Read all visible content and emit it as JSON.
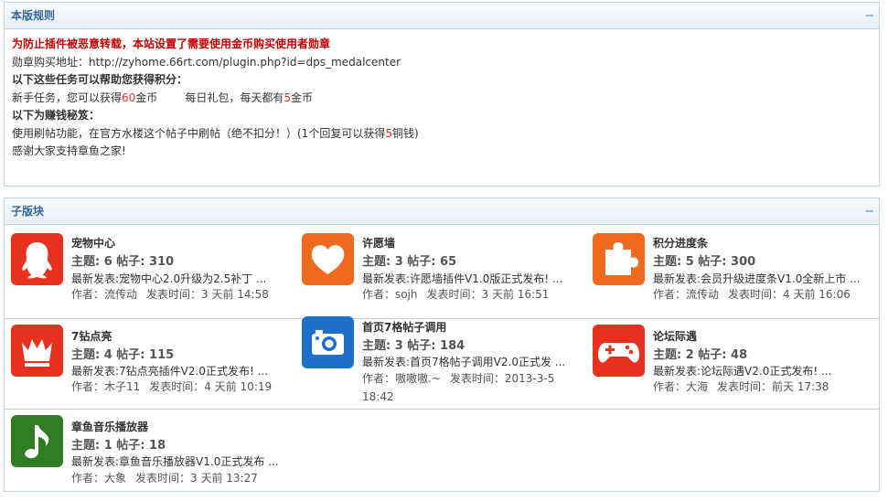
{
  "rules": {
    "header": "本版规则",
    "lines": {
      "warning": "为防止插件被恶意转载，本站设置了需要使用金币购买使用者勋章",
      "address_label": "勋章购买地址：",
      "address_url": "http://zyhome.66rt.com/plugin.php?id=dps_medalcenter",
      "tasks_heading": "以下这些任务可以帮助您获得积分：",
      "task1_pre": "新手任务，您可以获得",
      "task1_num": "60",
      "task1_post": "金币",
      "task2_pre": "每日礼包，每天都有",
      "task2_num": "5",
      "task2_post": "金币",
      "money_heading": "以下为赚钱秘笈：",
      "money_pre": "使用刷帖功能，在官方水楼这个帖子中刷帖（绝不扣分！）(1个回复可以获得",
      "money_num": "5",
      "money_post": "铜钱)",
      "thanks": "感谢大家支持章鱼之家!"
    }
  },
  "subforums": {
    "header": "子版块",
    "items": [
      {
        "title": "宠物中心",
        "stats": "主题: 6 帖子: 310",
        "last": "最新发表:宠物中心2.0升级为2.5补丁 ...",
        "author": "作者：流传动",
        "time": "发表时间：3 天前 14:58",
        "icon": "qq-penguin-icon",
        "color": "#e8301f"
      },
      {
        "title": "许愿墙",
        "stats": "主题: 3 帖子: 65",
        "last": "最新发表:许愿墙插件V1.0版正式发布! ...",
        "author": "作者：sojh",
        "time": "发表时间：3 天前 16:51",
        "icon": "heart-icon",
        "color": "#f06a1d"
      },
      {
        "title": "积分进度条",
        "stats": "主题: 5 帖子: 300",
        "last": "最新发表:会员升级进度条V1.0全新上市 ...",
        "author": "作者：流传动",
        "time": "发表时间：4 天前 16:06",
        "icon": "puzzle-icon",
        "color": "#f06a1d"
      },
      {
        "title": "7钻点亮",
        "stats": "主题: 4 帖子: 115",
        "last": "最新发表:7钻点亮插件V2.0正式发布! ...",
        "author": "作者：木子11",
        "time": "发表时间：4 天前 10:19",
        "icon": "crown-icon",
        "color": "#e8301f"
      },
      {
        "title": "首页7格帖子调用",
        "stats": "主题: 3 帖子: 184",
        "last": "最新发表:首页7格帖子调用V2.0正式发 ...",
        "author": "作者：嗷嗷嗷.~",
        "time": "发表时间：2013-3-5 18:42",
        "icon": "camera-icon",
        "color": "#1e6fc8"
      },
      {
        "title": "论坛际遇",
        "stats": "主题: 2 帖子: 48",
        "last": "最新发表:论坛际遇V2.0正式发布! ...",
        "author": "作者：大海",
        "time": "发表时间：前天 17:38",
        "icon": "gamepad-icon",
        "color": "#e8301f"
      },
      {
        "title": "章鱼音乐播放器",
        "stats": "主题: 1 帖子: 18",
        "last": "最新发表:章鱼音乐播放器V1.0正式发布 ...",
        "author": "作者：大象",
        "time": "发表时间：3 天前 13:27",
        "icon": "music-note-icon",
        "color": "#2e7d22"
      }
    ]
  }
}
